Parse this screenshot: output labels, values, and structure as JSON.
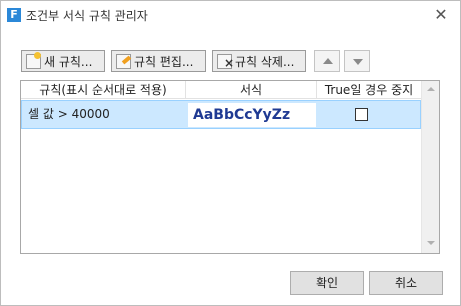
{
  "window": {
    "title": "조건부 서식 규칙 관리자",
    "app_icon_letter": "F",
    "close_glyph": "✕"
  },
  "toolbar": {
    "new_rule_label": "새 규칙...",
    "edit_rule_label": "규칙 편집...",
    "delete_rule_label": "규칙 삭제..."
  },
  "rule_list": {
    "columns": [
      "규칙(표시 순서대로 적용)",
      "서식",
      "True일 경우 중지"
    ],
    "rows": [
      {
        "condition": "셀 값 > 40000",
        "format_preview": "AaBbCcYyZz",
        "stop_if_true": false,
        "selected": true
      }
    ]
  },
  "footer": {
    "ok_label": "확인",
    "cancel_label": "취소"
  },
  "colors": {
    "selected_row": "#cce8ff",
    "preview_text": "#1f3a93",
    "app_icon": "#2b88d8"
  }
}
